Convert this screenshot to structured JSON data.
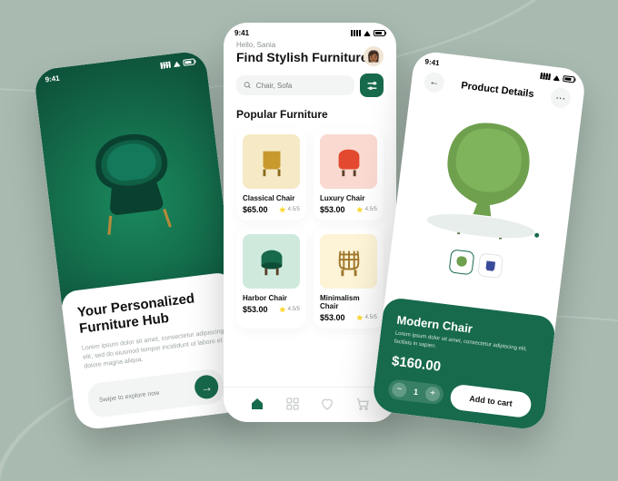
{
  "status_time": "9:41",
  "colors": {
    "brand": "#176a4c",
    "bg": "#a9bbb1"
  },
  "left": {
    "title_line1": "Your Personalized",
    "title_line2": "Furniture Hub",
    "desc": "Lorem ipsum dolor sit amet, consectetur adipiscing elit, sed do eiusmod tempor incididunt ut labore et dolore magna aliqua.",
    "swipe_label": "Swipe to explore now"
  },
  "mid": {
    "greeting": "Hello, Sania",
    "headline": "Find Stylish Furniture",
    "search_placeholder": "Chair, Sofa",
    "section": "Popular Furniture",
    "items": [
      {
        "name": "Classical Chair",
        "price": "$65.00",
        "rating": "4.5/5",
        "thumb_bg": "#f6e9c5"
      },
      {
        "name": "Luxury Chair",
        "price": "$53.00",
        "rating": "4.5/5",
        "thumb_bg": "#f9d9d0"
      },
      {
        "name": "Harbor Chair",
        "price": "$53.00",
        "rating": "4.5/5",
        "thumb_bg": "#cfeadd"
      },
      {
        "name": "Minimalism Chair",
        "price": "$53.00",
        "rating": "4.5/5",
        "thumb_bg": "#fdf3d6"
      }
    ]
  },
  "right": {
    "page_title": "Product Details",
    "name": "Modern Chair",
    "desc": "Lorem ipsum dolor sit amet, consectetur adipiscing elit, facilisis in sapien.",
    "price": "$160.00",
    "qty": "1",
    "add_label": "Add to cart"
  }
}
